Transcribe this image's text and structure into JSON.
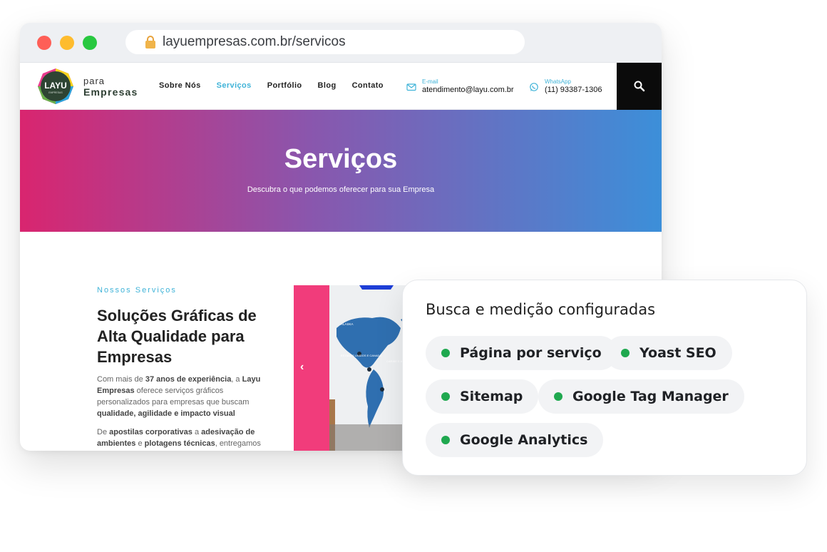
{
  "browser": {
    "url": "layuempresas.com.br/servicos"
  },
  "site": {
    "logo_text": "LAYU",
    "logo_subtext": "EMPRESAS",
    "logo_para": "para",
    "logo_empresas": "Empresas",
    "nav": [
      {
        "label": "Sobre Nós",
        "active": false
      },
      {
        "label": "Serviços",
        "active": true
      },
      {
        "label": "Portfólio",
        "active": false
      },
      {
        "label": "Blog",
        "active": false
      },
      {
        "label": "Contato",
        "active": false
      }
    ],
    "email_label": "E-mail",
    "email_value": "atendimento@layu.com.br",
    "whatsapp_label": "WhatsApp",
    "whatsapp_value": "(11) 93387-1306"
  },
  "hero": {
    "title": "Serviços",
    "subtitle": "Descubra o que podemos oferecer para sua Empresa"
  },
  "content": {
    "eyebrow": "Nossos Serviços",
    "heading": "Soluções Gráficas de Alta Qualidade para Empresas",
    "p1_a": "Com mais de ",
    "p1_b": "37 anos de experiência",
    "p1_c": ", a ",
    "p1_d": "Layu Empresas",
    "p1_e": " oferece serviços gráficos personalizados para empresas que buscam ",
    "p1_f": "qualidade, agilidade e impacto visual",
    "p2_a": "De ",
    "p2_b": "apostilas corporativas",
    "p2_c": " a ",
    "p2_d": "adesivação de ambientes",
    "p2_e": " e ",
    "p2_f": "plotagens técnicas",
    "p2_g": ", entregamos",
    "carousel_prev": "‹",
    "map_labels": [
      "ALASKA",
      "ESTADOS UNIDOS E CANADÁ",
      "CARIBE E AMÉRICA CENTRAL"
    ]
  },
  "card": {
    "title": "Busca e medição configuradas",
    "chips": [
      "Página por serviço",
      "Yoast SEO",
      "Sitemap",
      "Google Tag Manager",
      "Google Analytics"
    ],
    "status_color": "#1fa84f"
  },
  "colors": {
    "accent": "#3fb3d8",
    "hero_start": "#d9256f",
    "hero_end": "#3c8fd9",
    "pink": "#f13c7b"
  }
}
